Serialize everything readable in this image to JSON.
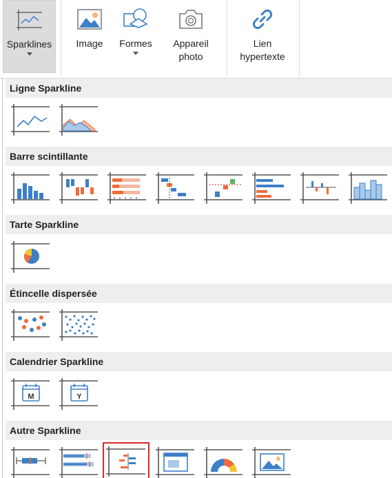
{
  "ribbon": {
    "sparklines": "Sparklines",
    "image": "Image",
    "formes": "Formes",
    "photo_line1": "Appareil",
    "photo_line2": "photo",
    "lien_line1": "Lien",
    "lien_line2": "hypertexte"
  },
  "sections": {
    "ligne": "Ligne Sparkline",
    "barre": "Barre scintillante",
    "tarte": "Tarte Sparkline",
    "etincelle": "Étincelle dispersée",
    "calendrier": "Calendrier Sparkline",
    "autre": "Autre Sparkline"
  },
  "calendar_letters": {
    "month": "M",
    "year": "Y"
  },
  "colors": {
    "blue": "#3d7fc8",
    "orange": "#ef6c3a",
    "peach": "#f6b8a0",
    "red": "#d42a2a",
    "green": "#5bb35b",
    "yellow": "#f4c430",
    "frame": "#555555",
    "header_bg": "#eeeeee"
  },
  "icons": [
    "sparklines-icon",
    "image-icon",
    "shapes-icon",
    "camera-icon",
    "hyperlink-icon",
    "line-sparkline-icon",
    "area-sparkline-icon",
    "column-sparkline-icon",
    "winloss-sparkline-icon",
    "stacked-bar-sparkline-icon",
    "cascade-sparkline-icon",
    "vari-sparkline-icon",
    "hbar-sparkline-icon",
    "pareto-sparkline-icon",
    "histogram-sparkline-icon",
    "pie-sparkline-icon",
    "scatter-sparkline-icon",
    "density-scatter-sparkline-icon",
    "month-calendar-icon",
    "year-calendar-icon",
    "bullet-sparkline-icon",
    "boxplot-sparkline-icon",
    "spread-sparkline-icon",
    "image-sparkline-icon",
    "gauge-sparkline-icon",
    "picture-sparkline-icon"
  ],
  "selected_tile": "spread-sparkline-icon"
}
